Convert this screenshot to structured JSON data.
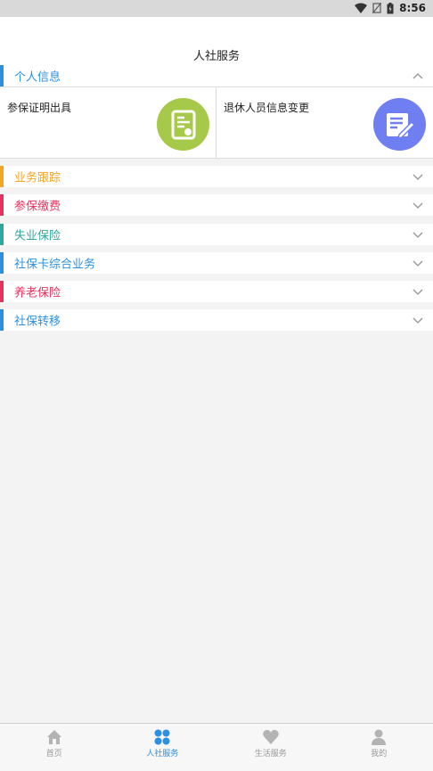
{
  "status": {
    "time": "8:56"
  },
  "header": {
    "title": "人社服务"
  },
  "personal": {
    "label": "个人信息",
    "items": [
      {
        "label": "参保证明出具",
        "icon": "certificate-icon",
        "color": "#a7c94a"
      },
      {
        "label": "退休人员信息变更",
        "icon": "edit-document-icon",
        "color": "#6f7ff2"
      }
    ]
  },
  "sections": [
    {
      "label": "业务跟踪",
      "color": "#f5a623"
    },
    {
      "label": "参保缴费",
      "color": "#e8325e"
    },
    {
      "label": "失业保险",
      "color": "#2fa7a0"
    },
    {
      "label": "社保卡综合业务",
      "color": "#2d8fe0"
    },
    {
      "label": "养老保险",
      "color": "#e8325e"
    },
    {
      "label": "社保转移",
      "color": "#2d8fe0"
    }
  ],
  "tabs": [
    {
      "label": "首页",
      "icon": "home-icon",
      "active": false
    },
    {
      "label": "人社服务",
      "icon": "apps-icon",
      "active": true
    },
    {
      "label": "生活服务",
      "icon": "heart-icon",
      "active": false
    },
    {
      "label": "我的",
      "icon": "user-icon",
      "active": false
    }
  ],
  "colors": {
    "accent": "#2d8fe0",
    "inactive": "#9a9a9a"
  }
}
